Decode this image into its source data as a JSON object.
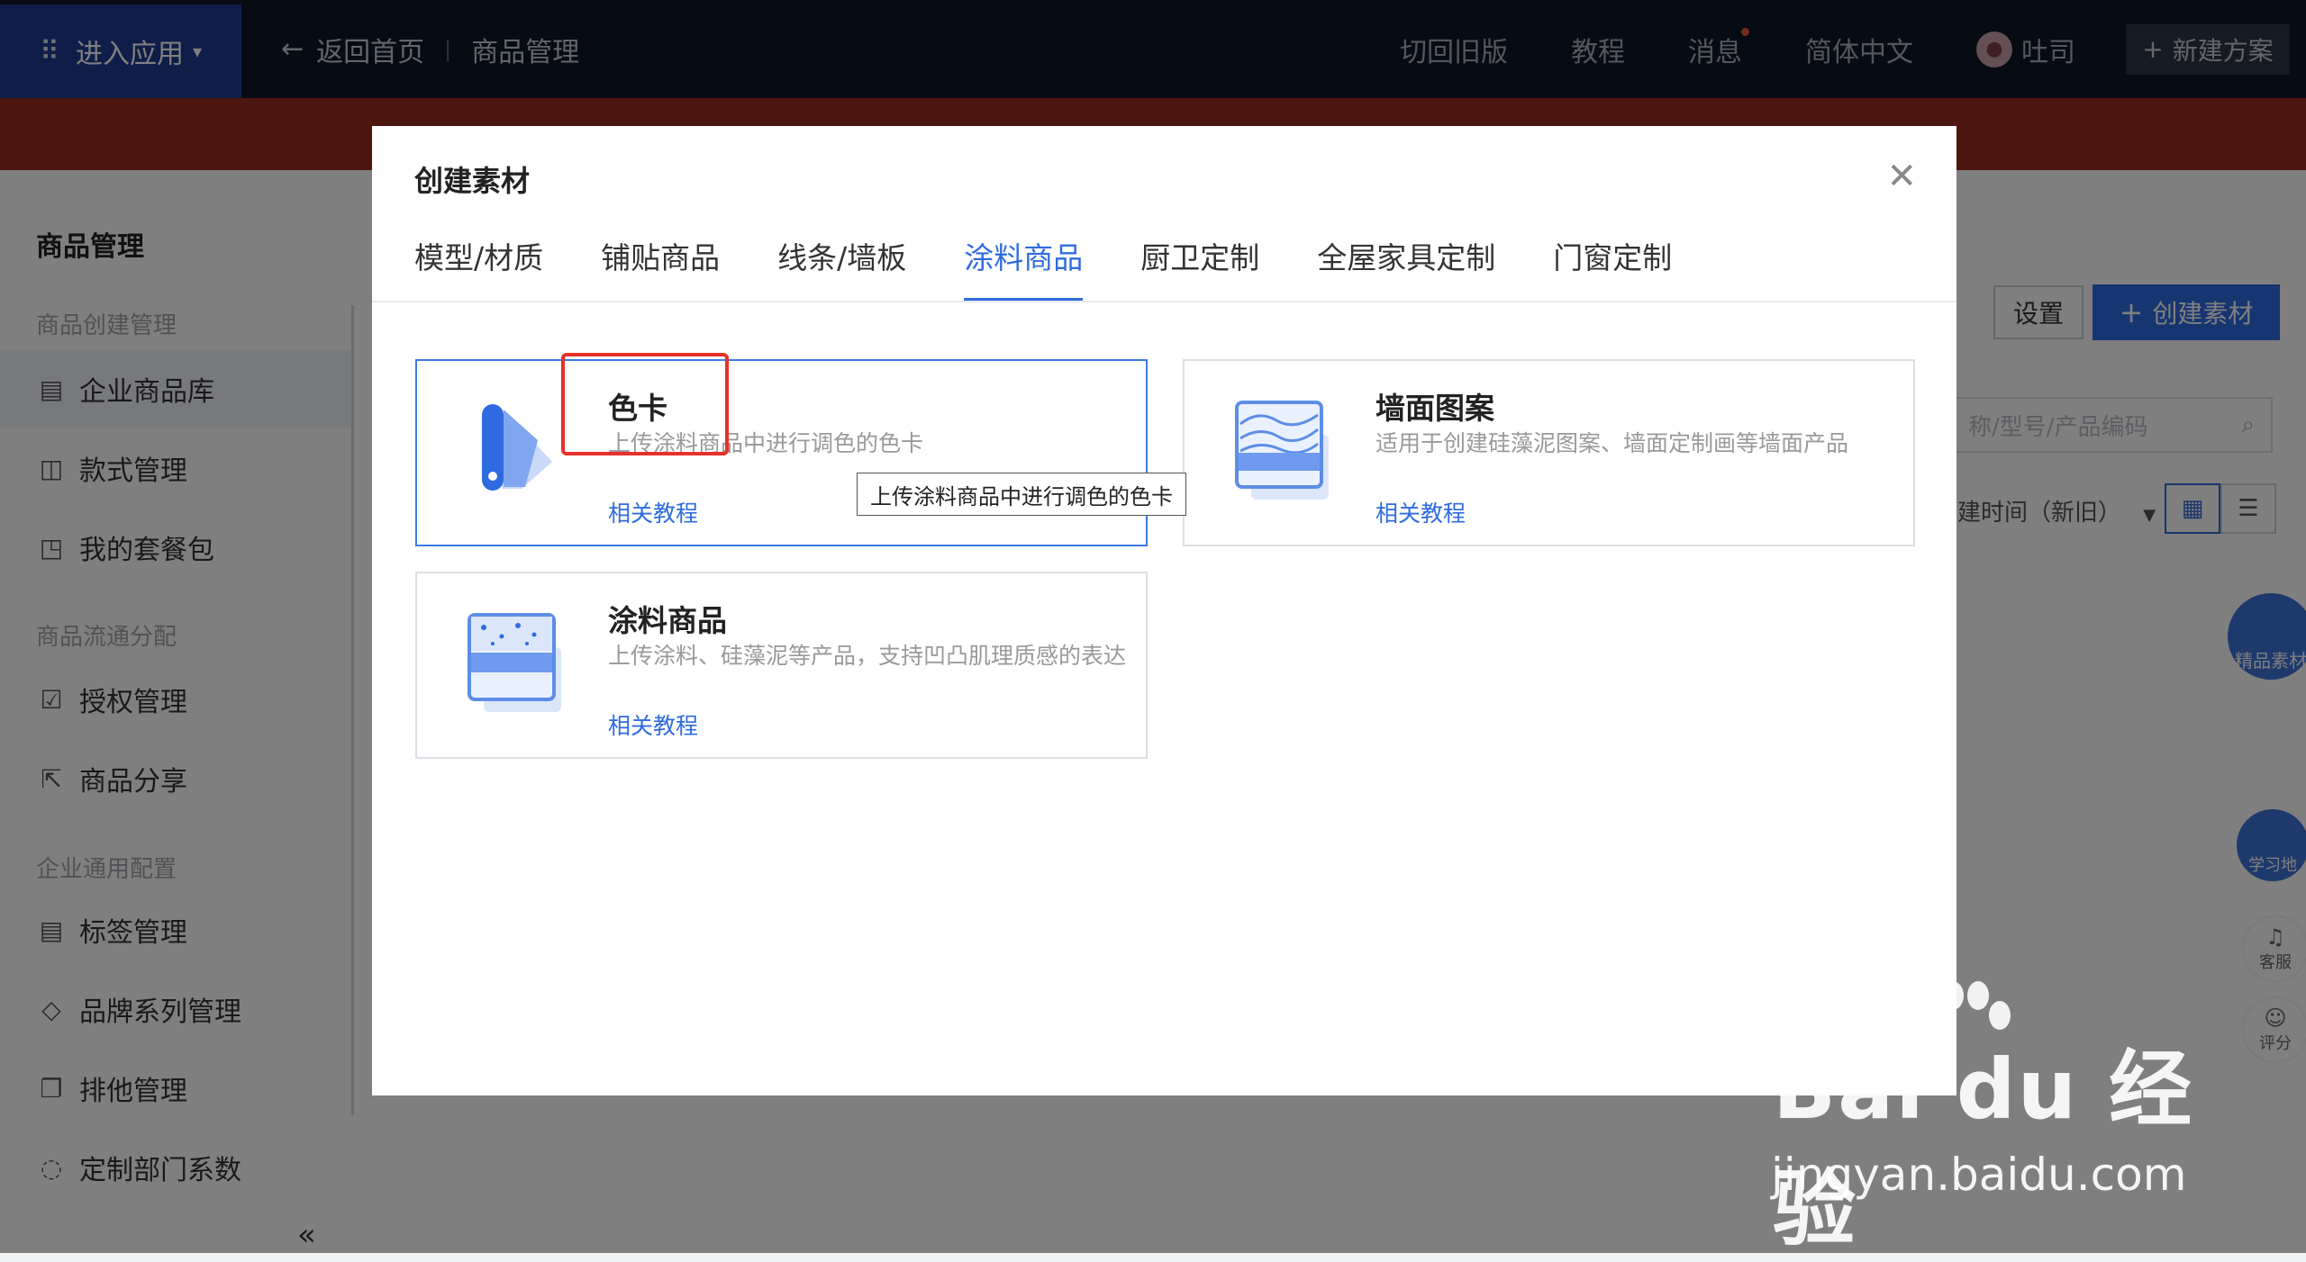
{
  "topbar": {
    "app_entry": "进入应用",
    "back_home": "返回首页",
    "crumb": "商品管理",
    "switch_old": "切回旧版",
    "tutorial": "教程",
    "messages": "消息",
    "language": "简体中文",
    "user_name": "吐司",
    "new_plan": "新建方案"
  },
  "sidebar": {
    "title": "商品管理",
    "groups": [
      "商品创建管理",
      "商品流通分配",
      "企业通用配置"
    ],
    "items": [
      {
        "label": "企业商品库",
        "icon": "catalog-icon"
      },
      {
        "label": "款式管理",
        "icon": "style-icon"
      },
      {
        "label": "我的套餐包",
        "icon": "package-icon"
      },
      {
        "label": "授权管理",
        "icon": "authorize-icon"
      },
      {
        "label": "商品分享",
        "icon": "share-icon"
      },
      {
        "label": "标签管理",
        "icon": "tag-list-icon"
      },
      {
        "label": "品牌系列管理",
        "icon": "tag-icon"
      },
      {
        "label": "排他管理",
        "icon": "copy-icon"
      },
      {
        "label": "定制部门系数",
        "icon": "bell-icon"
      }
    ],
    "collapse": "«"
  },
  "main_bg": {
    "settings_btn": "设置",
    "create_btn": "创建素材",
    "search_placeholder": "称/型号/产品编码",
    "sort_label": "建时间（新旧）",
    "premium_badge": "精品素材",
    "study_badge": "学习地",
    "service": "客服",
    "rating": "评分"
  },
  "modal": {
    "title": "创建素材",
    "tabs": [
      "模型/材质",
      "铺贴商品",
      "线条/墙板",
      "涂料商品",
      "厨卫定制",
      "全屋家具定制",
      "门窗定制"
    ],
    "active_tab": 3,
    "cards": [
      {
        "title": "色卡",
        "desc": "上传涂料商品中进行调色的色卡",
        "link": "相关教程"
      },
      {
        "title": "墙面图案",
        "desc": "适用于创建硅藻泥图案、墙面定制画等墙面产品",
        "link": "相关教程"
      },
      {
        "title": "涂料商品",
        "desc": "上传涂料、硅藻泥等产品，支持凹凸肌理质感的表达",
        "link": "相关教程"
      }
    ],
    "tooltip": "上传涂料商品中进行调色的色卡"
  },
  "watermark": {
    "logo_text": "Bai du 经验",
    "sub_text": "jingyan.baidu.com"
  },
  "colors": {
    "accent": "#2f6be0",
    "topbar_bg": "#0c1729",
    "highlight": "#e8302b"
  }
}
